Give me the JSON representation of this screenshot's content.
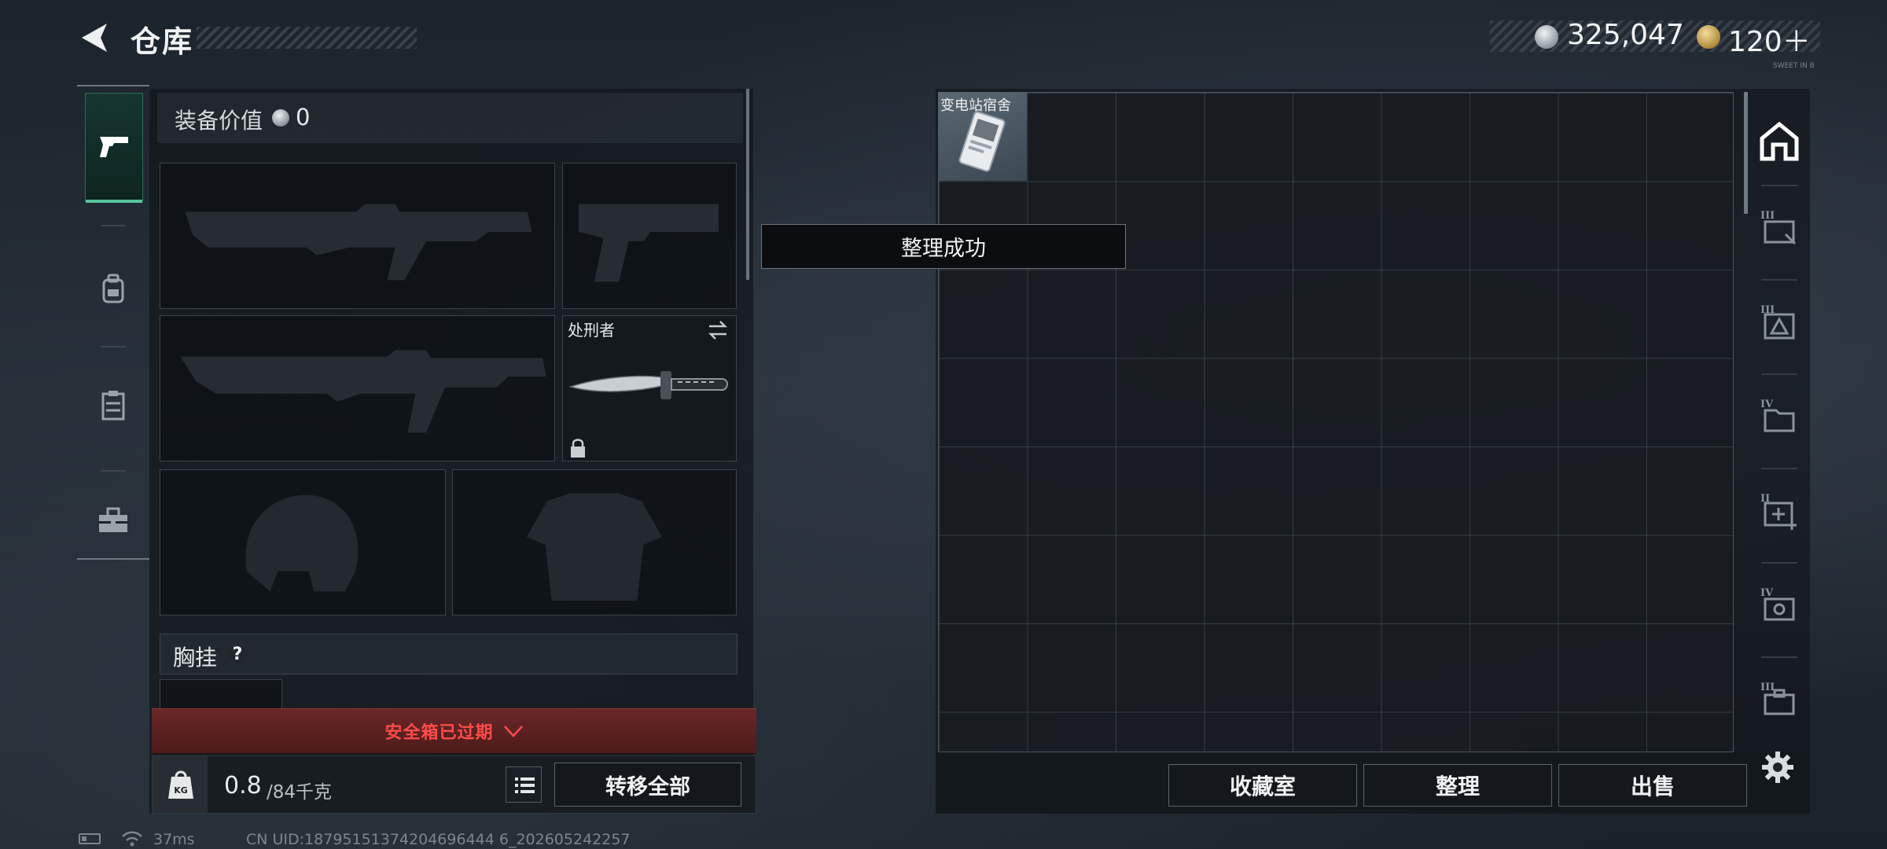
{
  "header": {
    "title": "仓库",
    "currency_primary": "325,047",
    "currency_secondary": "120＋",
    "corner_label": "SWEET IN B"
  },
  "left_tabs": [
    {
      "icon": "pistol-icon",
      "active": true
    },
    {
      "icon": "backpack-icon",
      "active": false
    },
    {
      "icon": "chest-rig-icon",
      "active": false
    },
    {
      "icon": "toolbox-icon",
      "active": false
    }
  ],
  "equipment": {
    "value_label": "装备价值",
    "value_amount": "0",
    "melee_name": "处刑者",
    "chest_rig_label": "胸挂",
    "chest_rig_help": "?",
    "safe_box_expired": "安全箱已过期",
    "weight_current": "0.8",
    "weight_max": "/84千克",
    "transfer_all": "转移全部"
  },
  "toast": {
    "message": "整理成功"
  },
  "storage": {
    "item_name": "变电站宿舍",
    "buttons": {
      "collection": "收藏室",
      "sort": "整理",
      "sell": "出售"
    },
    "tab_icons": [
      "home-storage-icon",
      "tier3-storage-icon",
      "tier3-box-icon",
      "tier4-folder-icon",
      "tier2-medical-icon",
      "tier4-gear-icon",
      "tier3-case-icon"
    ],
    "grid": {
      "columns": 9,
      "rows": 8
    }
  },
  "status": {
    "ping": "37ms",
    "uid": "CN UID:18795151374204696444 6_202605242257"
  },
  "colors": {
    "accent_green": "#57c59c",
    "alert_red": "#ff4b4b",
    "panel": "#12161b"
  }
}
